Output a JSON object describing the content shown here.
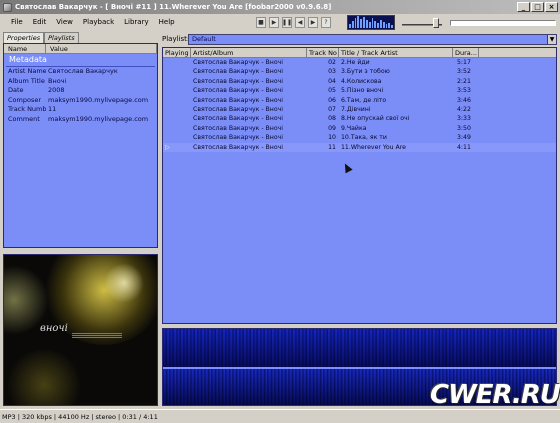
{
  "window": {
    "title": "Святослав Вакарчук - [ Вночі #11 ] 11.Wherever You Are  [foobar2000 v0.9.6.8]"
  },
  "menu": [
    "File",
    "Edit",
    "View",
    "Playback",
    "Library",
    "Help"
  ],
  "toolbar_icons": [
    "stop-icon",
    "play-icon",
    "pause-icon",
    "previous-icon",
    "next-icon",
    "random-icon"
  ],
  "properties": {
    "tabs": [
      "Properties",
      "Playlists"
    ],
    "columns": [
      "Name",
      "Value"
    ],
    "group": "Metadata",
    "rows": [
      {
        "name": "Artist Name",
        "value": "Святослав Вакарчук"
      },
      {
        "name": "Album Title",
        "value": "Вночі"
      },
      {
        "name": "Date",
        "value": "2008"
      },
      {
        "name": "Composer",
        "value": "maksym1990.mylivepage.com"
      },
      {
        "name": "Track Number",
        "value": "11"
      },
      {
        "name": "Comment",
        "value": "maksym1990.mylivepage.com"
      }
    ]
  },
  "album_art": {
    "text": "вночі"
  },
  "playlist": {
    "label": "Playlist:",
    "selected": "Default",
    "columns": [
      "Playing",
      "Artist/Album",
      "Track No",
      "Title / Track Artist",
      "Dura..."
    ],
    "tracks": [
      {
        "playing": "",
        "artist": "Святослав Вакарчук - Вночі",
        "track": "02",
        "title": "2.Не йди",
        "duration": "5:17"
      },
      {
        "playing": "",
        "artist": "Святослав Вакарчук - Вночі",
        "track": "03",
        "title": "3.Бути з тобою",
        "duration": "3:52"
      },
      {
        "playing": "",
        "artist": "Святослав Вакарчук - Вночі",
        "track": "04",
        "title": "4.Колискова",
        "duration": "2:21"
      },
      {
        "playing": "",
        "artist": "Святослав Вакарчук - Вночі",
        "track": "05",
        "title": "5.Пізно вночі",
        "duration": "3:53"
      },
      {
        "playing": "",
        "artist": "Святослав Вакарчук - Вночі",
        "track": "06",
        "title": "6.Там, де літо",
        "duration": "3:46"
      },
      {
        "playing": "",
        "artist": "Святослав Вакарчук - Вночі",
        "track": "07",
        "title": "7.Дівчині",
        "duration": "4:22"
      },
      {
        "playing": "",
        "artist": "Святослав Вакарчук - Вночі",
        "track": "08",
        "title": "8.Не опускай свої очі",
        "duration": "3:33"
      },
      {
        "playing": "",
        "artist": "Святослав Вакарчук - Вночі",
        "track": "09",
        "title": "9.Чайка",
        "duration": "3:50"
      },
      {
        "playing": "",
        "artist": "Святослав Вакарчук - Вночі",
        "track": "10",
        "title": "10.Така, як ти",
        "duration": "3:49"
      },
      {
        "playing": "▷",
        "artist": "Святослав Вакарчук - Вночі",
        "track": "11",
        "title": "11.Wherever You Are",
        "duration": "4:11"
      }
    ]
  },
  "status": "MP3 | 320 kbps | 44100 Hz | stereo | 0:31 / 4:11",
  "watermark": "CWER.RU",
  "colors": {
    "panel": "#7b8ef8",
    "spectrum": "#0c1046"
  }
}
